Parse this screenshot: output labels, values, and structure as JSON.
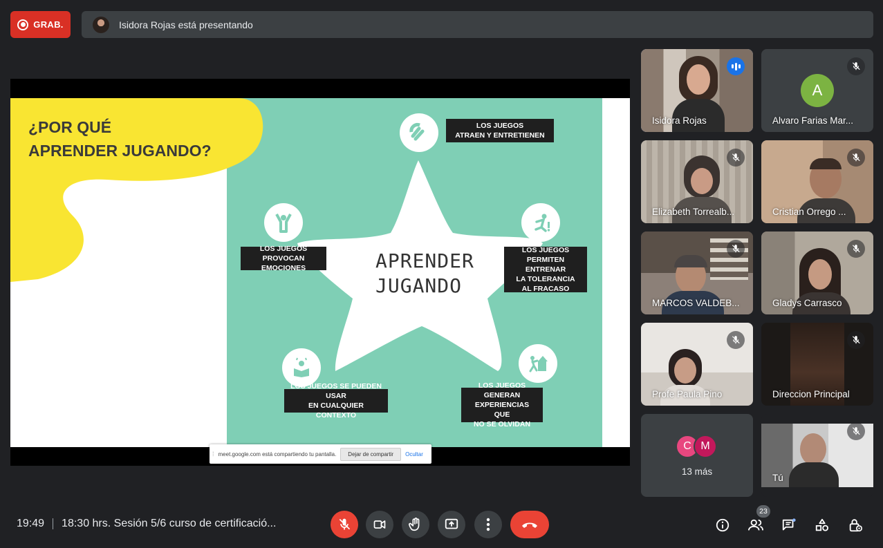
{
  "recording": {
    "label": "GRAB."
  },
  "presenting": {
    "text": "Isidora Rojas está presentando"
  },
  "slide": {
    "title_line1": "¿POR QUÉ",
    "title_line2": "APRENDER JUGANDO?",
    "center_line1": "APRENDER",
    "center_line2": "JUGANDO",
    "items": [
      {
        "line1": "LOS JUEGOS",
        "line2": "ATRAEN Y ENTRETIENEN"
      },
      {
        "line1": "LOS JUEGOS",
        "line2": "PERMITEN ENTRENAR",
        "line3": "LA TOLERANCIA",
        "line4": "AL FRACASO"
      },
      {
        "line1": "LOS JUEGOS GENERAN",
        "line2": "EXPERIENCIAS QUE",
        "line3": "NO SE OLVIDAN"
      },
      {
        "line1": "LOS JUEGOS SE PUEDEN USAR",
        "line2": "EN CUALQUIER CONTEXTO"
      },
      {
        "line1": "LOS JUEGOS",
        "line2": "PROVOCAN EMOCIONES"
      }
    ],
    "colors": {
      "mint": "#7fcfb5",
      "yellow": "#f9e532"
    }
  },
  "share_notice": {
    "text": "meet.google.com está compartiendo tu pantalla.",
    "stop_label": "Dejar de compartir",
    "hide_label": "Ocultar"
  },
  "participants": [
    {
      "name": "Isidora Rojas",
      "speaking": true
    },
    {
      "name": "Alvaro Farias Mar...",
      "initial": "A",
      "muted": true
    },
    {
      "name": "Elizabeth Torrealb...",
      "muted": true
    },
    {
      "name": "Cristian Orrego ...",
      "muted": true
    },
    {
      "name": "MARCOS VALDEB...",
      "muted": true
    },
    {
      "name": "Gladys Carrasco",
      "muted": true
    },
    {
      "name": "Profe Paula Pino",
      "muted": true
    },
    {
      "name": "Direccion Principal",
      "muted": true
    },
    {
      "name": "Tú",
      "muted": true
    }
  ],
  "more_tile": {
    "initials": [
      "C",
      "M"
    ],
    "label": "13 más"
  },
  "meeting": {
    "time": "19:49",
    "title": "18:30 hrs. Sesión 5/6 curso de certificació..."
  },
  "people_count": "23",
  "icons": [
    "mic-off-icon",
    "camera-icon",
    "hand-icon",
    "present-icon",
    "more-vert-icon",
    "end-call-icon",
    "info-icon",
    "people-icon",
    "chat-icon",
    "activities-icon",
    "host-controls-icon"
  ],
  "colors": {
    "danger": "#ea4335",
    "accent": "#8ab4f8",
    "surface": "#3c4043"
  }
}
